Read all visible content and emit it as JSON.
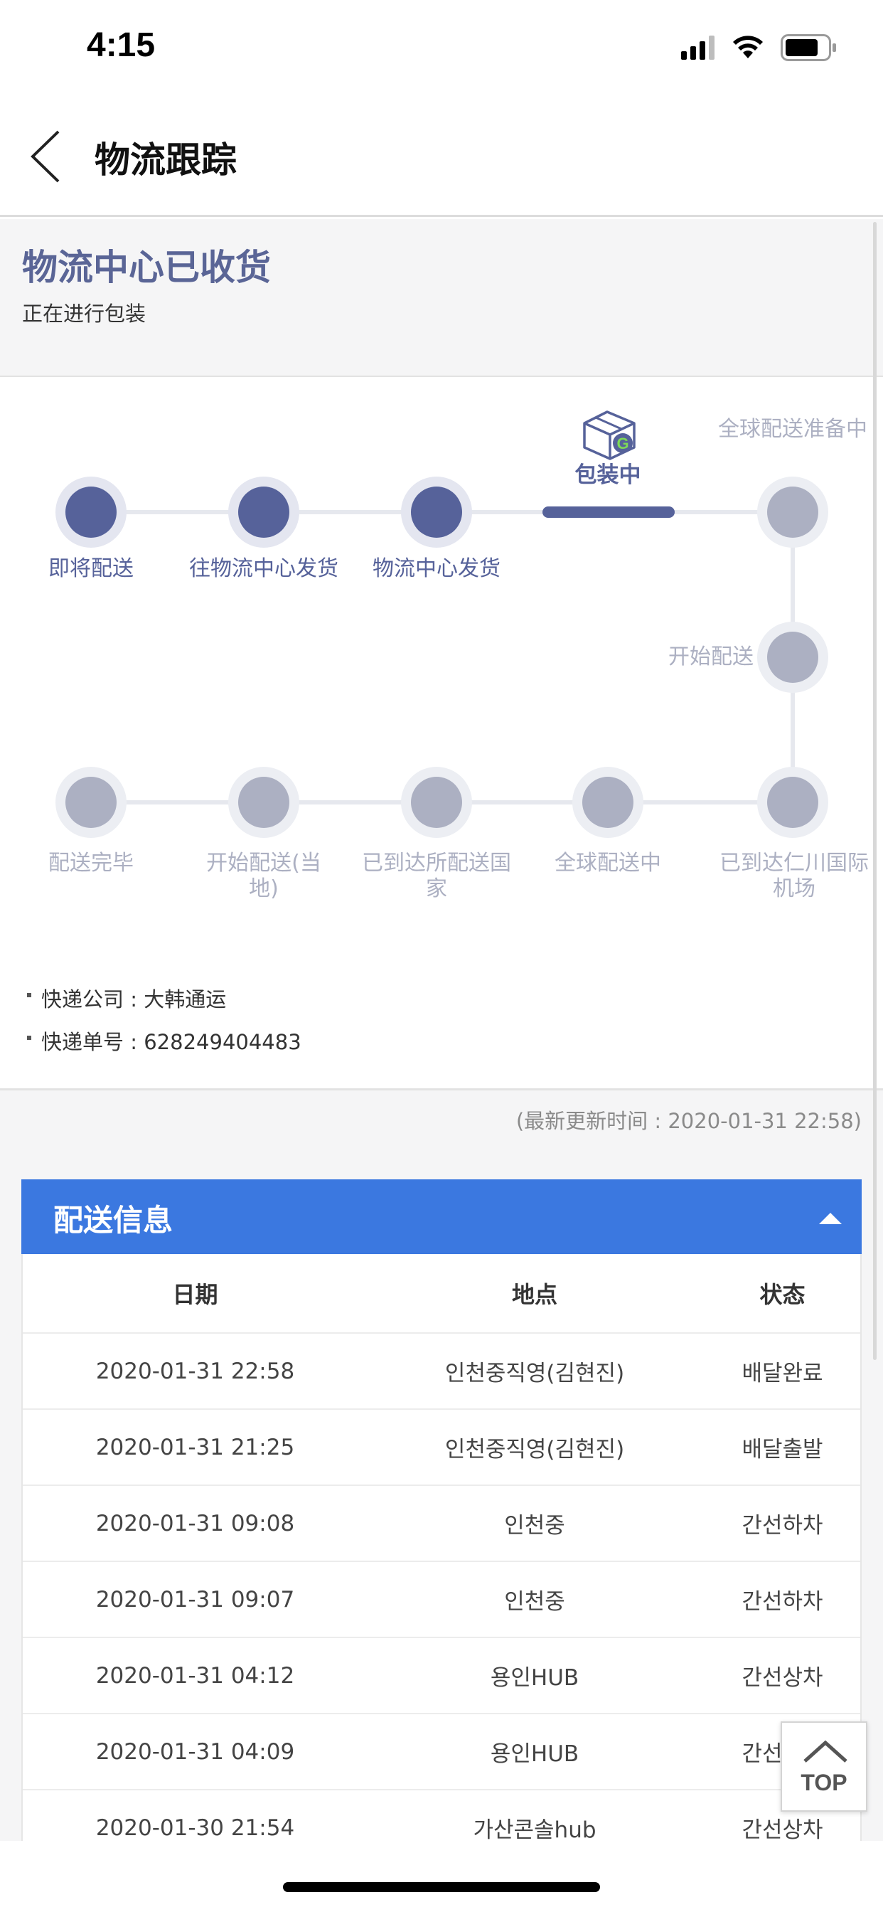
{
  "status_bar": {
    "time": "4:15"
  },
  "header": {
    "title": "物流跟踪"
  },
  "status": {
    "title": "物流中心已收货",
    "subtitle": "正在进行包装"
  },
  "tracker": {
    "steps": [
      {
        "label": "即将配送",
        "state": "done"
      },
      {
        "label": "往物流中心发货",
        "state": "done"
      },
      {
        "label": "物流中心发货",
        "state": "done"
      },
      {
        "label": "包装中",
        "state": "current"
      },
      {
        "label": "全球配送准备中",
        "state": "pending"
      },
      {
        "label": "开始配送",
        "state": "pending"
      },
      {
        "label": "已到达仁川国际机场",
        "state": "pending"
      },
      {
        "label": "全球配送中",
        "state": "pending"
      },
      {
        "label": "已到达所配送国家",
        "state": "pending"
      },
      {
        "label": "开始配送(当地)",
        "state": "pending"
      },
      {
        "label": "配送完毕",
        "state": "pending"
      }
    ],
    "current_icon": "package-box-icon",
    "colors": {
      "done": "#56629a",
      "pending": "#acb0c2",
      "line": "#e6e8ee"
    }
  },
  "shipping": {
    "company_label": "快递公司",
    "company": "大韩通运",
    "number_label": "快递单号",
    "number": "628249404483"
  },
  "update_time": "(最新更新时间 : 2020-01-31 22:58)",
  "delivery_panel": {
    "title": "配送信息",
    "columns": [
      "日期",
      "地点",
      "状态"
    ],
    "rows": [
      [
        "2020-01-31 22:58",
        "인천중직영(김현진)",
        "배달완료"
      ],
      [
        "2020-01-31 21:25",
        "인천중직영(김현진)",
        "배달출발"
      ],
      [
        "2020-01-31 09:08",
        "인천중",
        "간선하차"
      ],
      [
        "2020-01-31 09:07",
        "인천중",
        "간선하차"
      ],
      [
        "2020-01-31 04:12",
        "용인HUB",
        "간선상차"
      ],
      [
        "2020-01-31 04:09",
        "용인HUB",
        "간선하차"
      ],
      [
        "2020-01-30 21:54",
        "가산콘솔hub",
        "간선상차"
      ]
    ],
    "accent": "#3b78e0"
  },
  "top_button": {
    "label": "TOP"
  }
}
